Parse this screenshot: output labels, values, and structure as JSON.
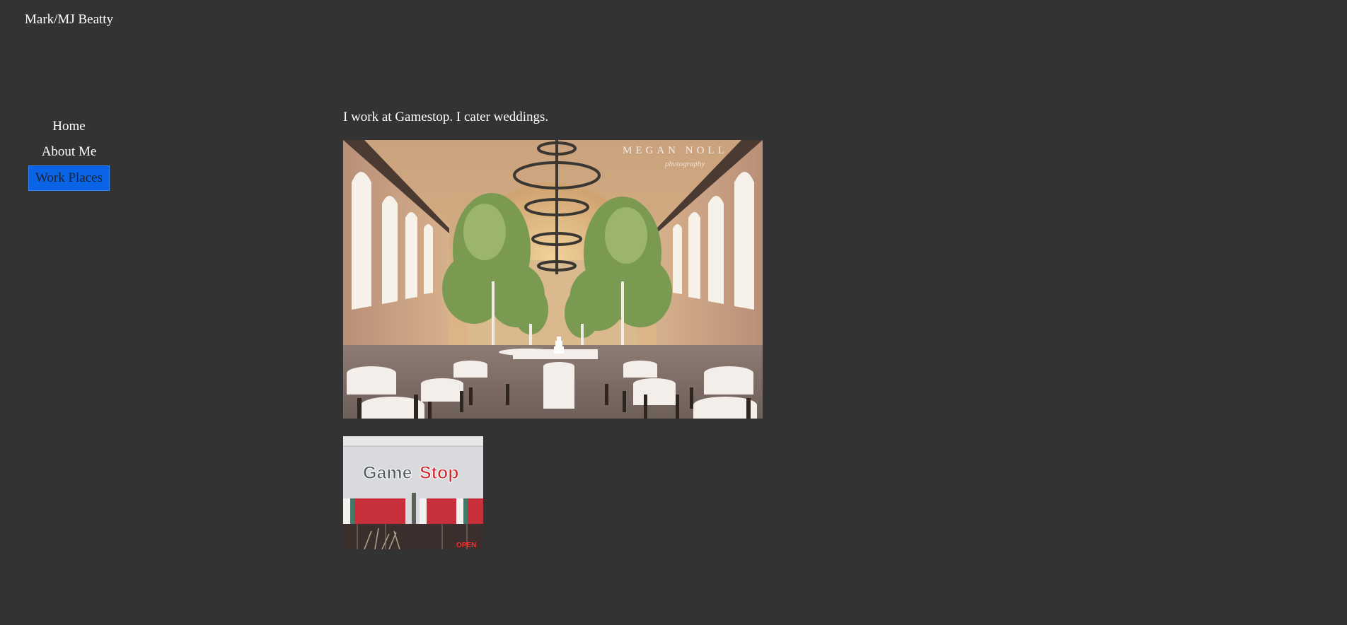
{
  "site": {
    "title": "Mark/MJ Beatty"
  },
  "nav": {
    "items": [
      {
        "label": "Home"
      },
      {
        "label": "About Me"
      },
      {
        "label": "Work Places"
      }
    ]
  },
  "main": {
    "intro": "I work at Gamestop. I cater weddings.",
    "wedding_photo": {
      "watermark_name": "MEGAN NOLL",
      "watermark_sub": "photography"
    },
    "gamestop_photo": {
      "logo_game": "Game",
      "logo_stop": "Stop",
      "open_sign": "OPEN"
    }
  },
  "colors": {
    "background": "#333333",
    "text": "#ffffff",
    "nav_active_bg": "#0a64e6"
  }
}
